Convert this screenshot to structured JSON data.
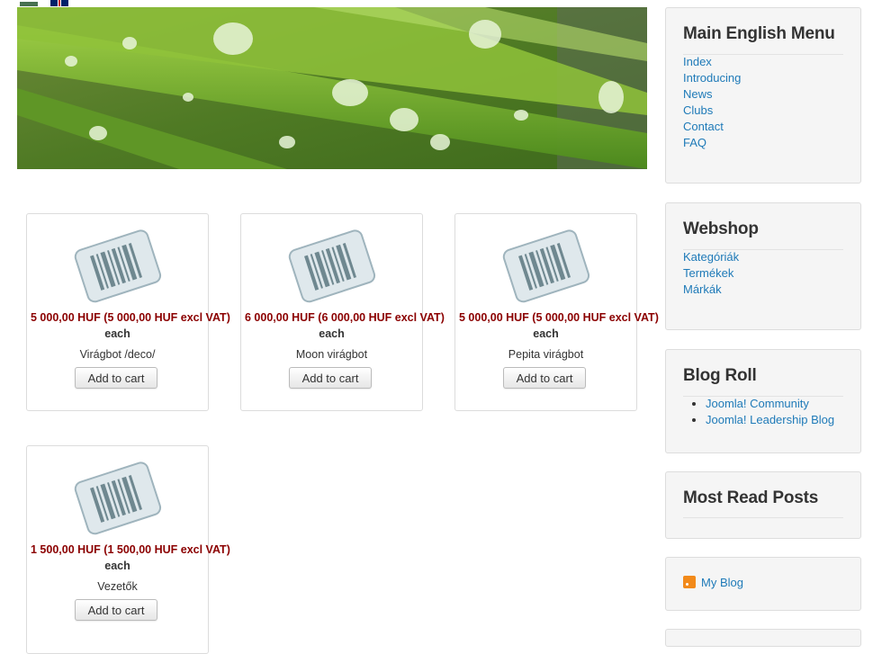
{
  "flags": [
    "hu-flag-icon",
    "en-flag-icon"
  ],
  "products": [
    {
      "price": "5 000,00 HUF (5 000,00 HUF excl VAT)",
      "unit": "each",
      "name": "Virágbot /deco/",
      "button": "Add to cart"
    },
    {
      "price": "6 000,00 HUF (6 000,00 HUF excl VAT)",
      "unit": "each",
      "name": "Moon virágbot",
      "button": "Add to cart"
    },
    {
      "price": "5 000,00 HUF (5 000,00 HUF excl VAT)",
      "unit": "each",
      "name": "Pepita virágbot",
      "button": "Add to cart"
    },
    {
      "price": "1 500,00 HUF (1 500,00 HUF excl VAT)",
      "unit": "each",
      "name": "Vezetők",
      "button": "Add to cart"
    }
  ],
  "sidebar": {
    "main_menu": {
      "title": "Main English Menu",
      "items": [
        "Index",
        "Introducing",
        "News",
        "Clubs",
        "Contact",
        "FAQ"
      ]
    },
    "webshop": {
      "title": "Webshop",
      "items": [
        "Kategóriák",
        "Termékek",
        "Márkák"
      ]
    },
    "blog_roll": {
      "title": "Blog Roll",
      "items": [
        "Joomla! Community",
        "Joomla! Leadership Blog"
      ]
    },
    "most_read": {
      "title": "Most Read Posts"
    },
    "feed": {
      "label": "My Blog",
      "icon": "rss-icon"
    }
  },
  "colors": {
    "link": "#1e7ab8",
    "price": "#8b0000",
    "panel": "#f5f5f5"
  }
}
